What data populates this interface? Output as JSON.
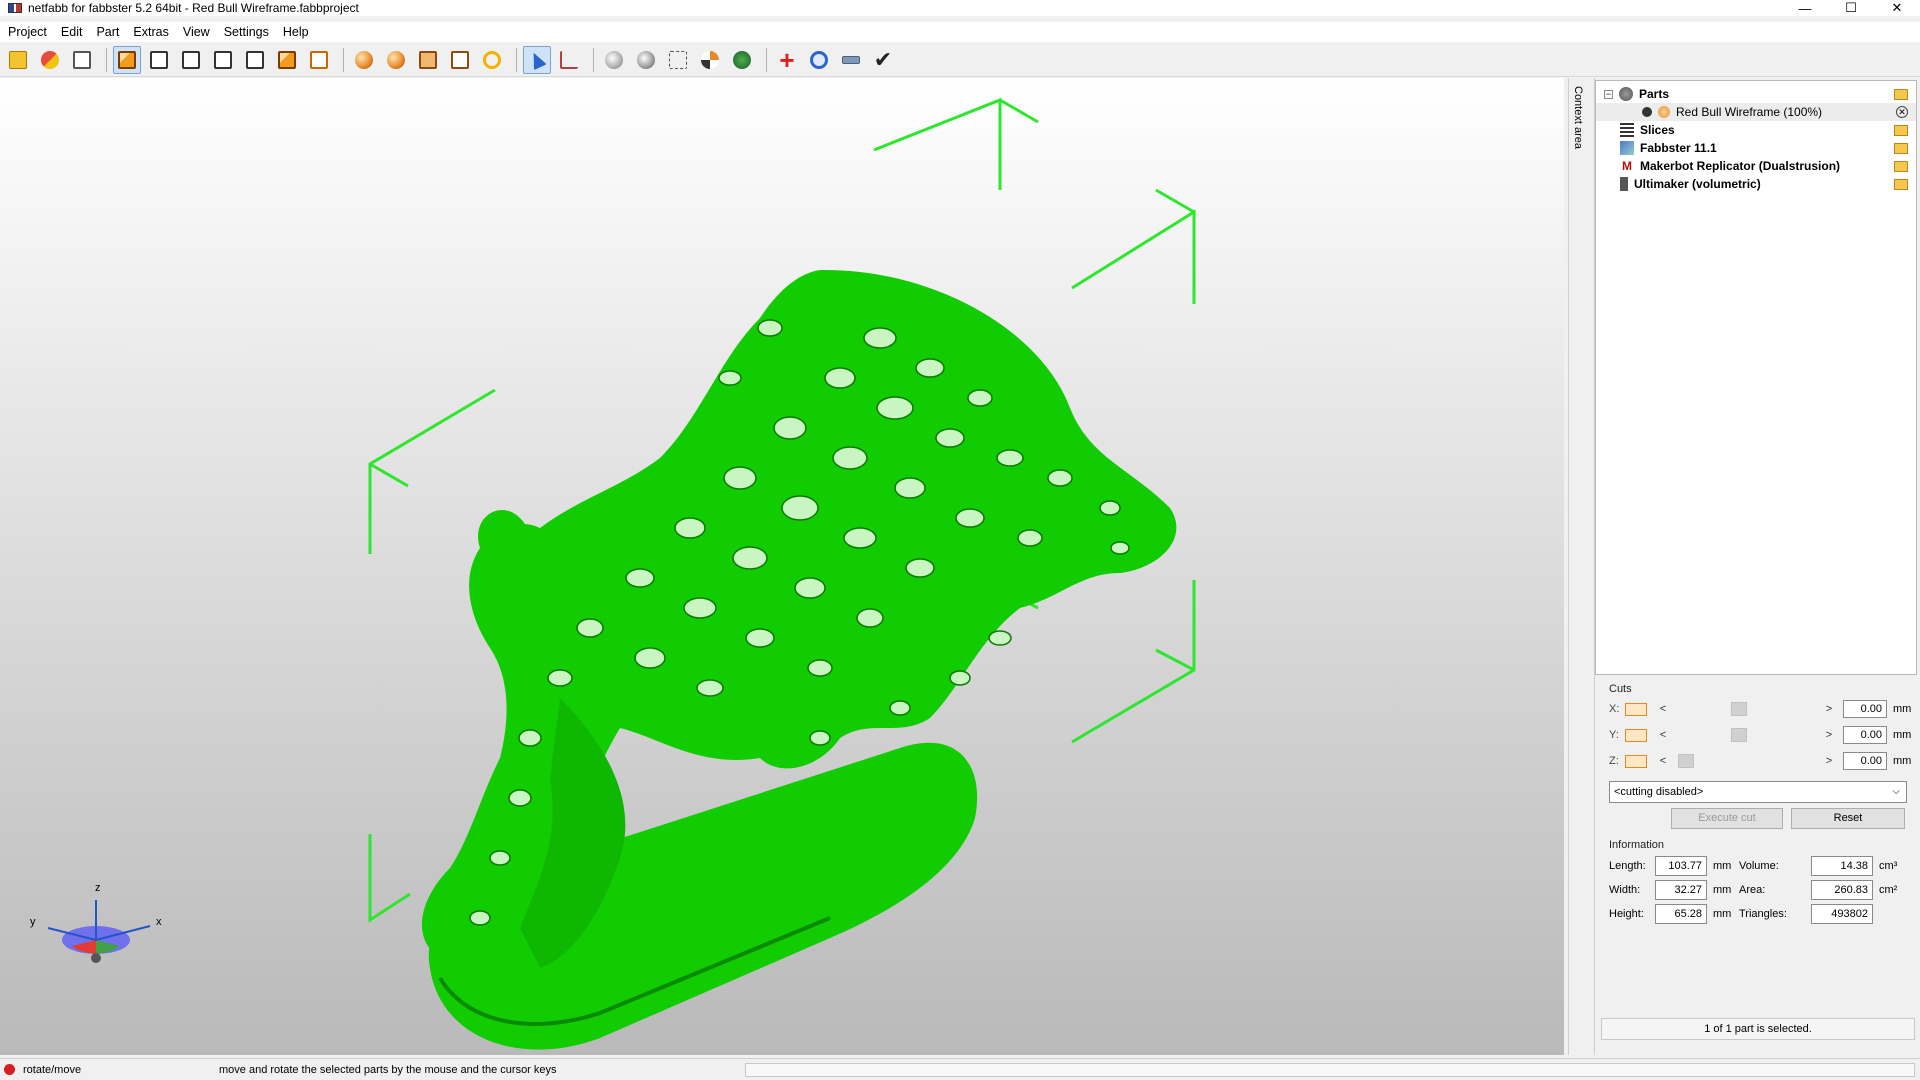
{
  "window": {
    "title": "netfabb for fabbster 5.2 64bit - Red Bull Wireframe.fabbproject",
    "minimize": "—",
    "maximize": "☐",
    "close": "✕"
  },
  "menu": [
    "Project",
    "Edit",
    "Part",
    "Extras",
    "View",
    "Settings",
    "Help"
  ],
  "toolbar": {
    "icons": [
      "open-project-icon",
      "add-part-icon",
      "settings-doc-icon",
      "view-front-icon",
      "view-back-icon",
      "view-left-icon",
      "view-right-icon",
      "view-top-icon",
      "view-bottom-icon",
      "view-iso-icon",
      "render-shaded-icon",
      "render-solid-icon",
      "render-box-icon",
      "render-frame-icon",
      "zoom-icon",
      "select-pointer-icon",
      "measure-axis-icon",
      "shading-icon",
      "sphere-icon",
      "align-icon",
      "section-icon",
      "color-icon",
      "repair-plus-icon",
      "analysis-icon",
      "ruler-icon",
      "checkmark-icon"
    ]
  },
  "viewport": {
    "axis_labels": {
      "z": "z",
      "y": "y",
      "x": "x"
    },
    "model_color": "#11cc00",
    "frame_color": "#2ee62e"
  },
  "context_tab": "Context area",
  "tree": {
    "parts_label": "Parts",
    "part_item": "Red Bull Wireframe (100%)",
    "slices_label": "Slices",
    "machines": [
      "Fabbster 11.1",
      "Makerbot Replicator (Dualstrusion)",
      "Ultimaker (volumetric)"
    ]
  },
  "cuts": {
    "label": "Cuts",
    "axes": [
      {
        "axis": "X:",
        "value": "0.00",
        "unit": "mm",
        "slider_fraction": 0.45
      },
      {
        "axis": "Y:",
        "value": "0.00",
        "unit": "mm",
        "slider_fraction": 0.45
      },
      {
        "axis": "Z:",
        "value": "0.00",
        "unit": "mm",
        "slider_fraction": 0.05
      }
    ],
    "mode": "<cutting disabled>",
    "execute_label": "Execute cut",
    "reset_label": "Reset"
  },
  "information": {
    "label": "Information",
    "length_label": "Length:",
    "length": "103.77",
    "length_unit": "mm",
    "width_label": "Width:",
    "width": "32.27",
    "width_unit": "mm",
    "height_label": "Height:",
    "height": "65.28",
    "height_unit": "mm",
    "volume_label": "Volume:",
    "volume": "14.38",
    "volume_unit": "cm³",
    "area_label": "Area:",
    "area": "260.83",
    "area_unit": "cm²",
    "triangles_label": "Triangles:",
    "triangles": "493802"
  },
  "selection_status": "1 of 1 part is selected.",
  "statusbar": {
    "mode": "rotate/move",
    "hint": "move and rotate the selected parts by the mouse and the cursor keys"
  }
}
